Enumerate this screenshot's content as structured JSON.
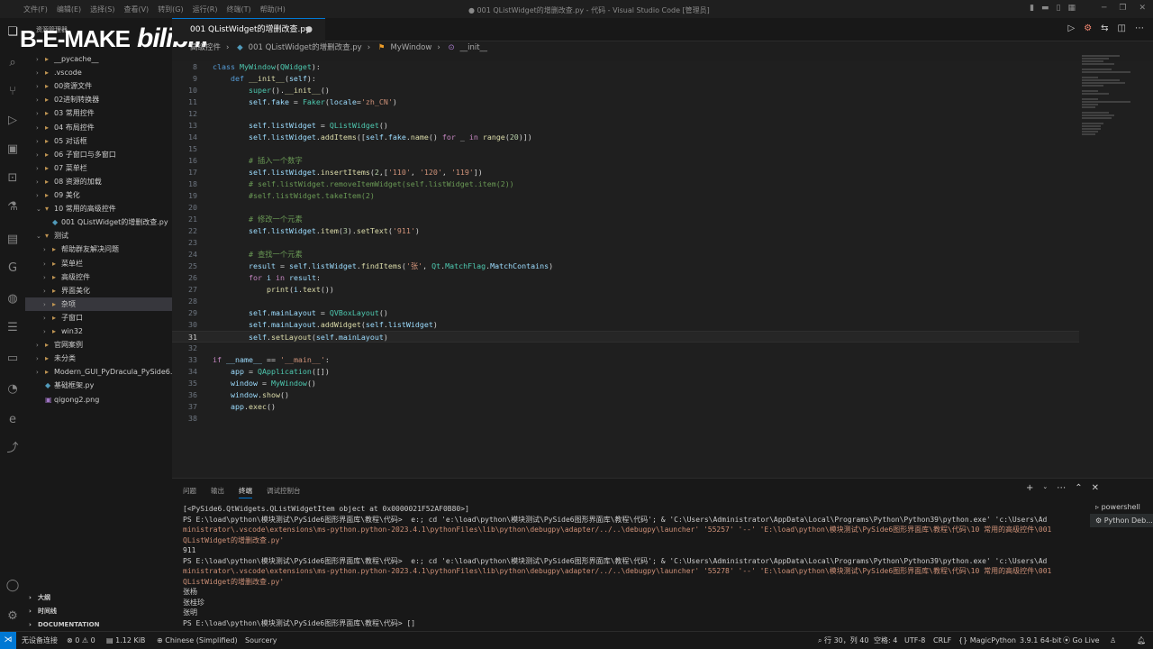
{
  "titlebar": {
    "menus": [
      "文件(F)",
      "编辑(E)",
      "选择(S)",
      "查看(V)",
      "转到(G)",
      "运行(R)",
      "终端(T)",
      "帮助(H)"
    ],
    "window_title": "● 001 QListWidget的增删改查.py - 代码 - Visual Studio Code [管理员]"
  },
  "watermark": {
    "brand": "B-E-MAKE",
    "logo": "bilibili"
  },
  "sidebar": {
    "title": "资源管理器",
    "items": [
      {
        "label": "__pycache__",
        "type": "folder",
        "indent": 1
      },
      {
        "label": ".vscode",
        "type": "folder",
        "indent": 1
      },
      {
        "label": "00资源文件",
        "type": "folder",
        "indent": 1
      },
      {
        "label": "02进制转换器",
        "type": "folder",
        "indent": 1
      },
      {
        "label": "03 常用控件",
        "type": "folder",
        "indent": 1
      },
      {
        "label": "04 布局控件",
        "type": "folder",
        "indent": 1
      },
      {
        "label": "05 对话框",
        "type": "folder",
        "indent": 1
      },
      {
        "label": "06 子窗口与多窗口",
        "type": "folder",
        "indent": 1
      },
      {
        "label": "07 菜单栏",
        "type": "folder",
        "indent": 1
      },
      {
        "label": "08 资源的加载",
        "type": "folder",
        "indent": 1
      },
      {
        "label": "09 美化",
        "type": "folder",
        "indent": 1
      },
      {
        "label": "10 常用的高级控件",
        "type": "folder-open",
        "indent": 1
      },
      {
        "label": "001 QListWidget的增删改查.py",
        "type": "py",
        "indent": 2
      },
      {
        "label": "测试",
        "type": "folder-open",
        "indent": 1
      },
      {
        "label": "帮助群友解决问题",
        "type": "folder",
        "indent": 2
      },
      {
        "label": "菜单栏",
        "type": "folder",
        "indent": 2
      },
      {
        "label": "高级控件",
        "type": "folder",
        "indent": 2
      },
      {
        "label": "界面美化",
        "type": "folder",
        "indent": 2
      },
      {
        "label": "杂项",
        "type": "folder",
        "indent": 2,
        "selected": true
      },
      {
        "label": "子窗口",
        "type": "folder",
        "indent": 2
      },
      {
        "label": "win32",
        "type": "folder",
        "indent": 2
      },
      {
        "label": "官网案例",
        "type": "folder",
        "indent": 1
      },
      {
        "label": "未分类",
        "type": "folder",
        "indent": 1
      },
      {
        "label": "Modern_GUI_PyDracula_PySide6...",
        "type": "folder",
        "indent": 1
      },
      {
        "label": "基础框架.py",
        "type": "py",
        "indent": 1
      },
      {
        "label": "qigong2.png",
        "type": "img",
        "indent": 1
      }
    ],
    "bottom_sections": [
      "大纲",
      "时间线",
      "DOCUMENTATION"
    ]
  },
  "editor": {
    "tab_label": "001 QListWidget的增删改查.py",
    "tab_dirty": "●",
    "breadcrumb": [
      "高级控件",
      "001 QListWidget的增删改查.py",
      "MyWindow",
      "__init__"
    ],
    "current_line": "30"
  },
  "panel": {
    "tabs": [
      "问题",
      "输出",
      "终端",
      "调试控制台"
    ],
    "active_tab": "终端",
    "terminal_lines": [
      "[<PySide6.QtWidgets.QListWidgetItem object at 0x0000021F52AF0B80>]",
      "PS E:\\load\\python\\模块测试\\PySide6图形界面库\\教程\\代码>  e:; cd 'e:\\load\\python\\模块测试\\PySide6图形界面库\\教程\\代码'; & 'C:\\Users\\Administrator\\AppData\\Local\\Programs\\Python\\Python39\\python.exe' 'c:\\Users\\Ad",
      "ministrator\\.vscode\\extensions\\ms-python.python-2023.4.1\\pythonFiles\\lib\\python\\debugpy\\adapter/../..\\debugpy\\launcher' '55257' '--' 'E:\\load\\python\\模块测试\\PySide6图形界面库\\教程\\代码\\10 常用的高级控件\\001",
      "QListWidget的增删改查.py'",
      "911",
      "PS E:\\load\\python\\模块测试\\PySide6图形界面库\\教程\\代码>  e:; cd 'e:\\load\\python\\模块测试\\PySide6图形界面库\\教程\\代码'; & 'C:\\Users\\Administrator\\AppData\\Local\\Programs\\Python\\Python39\\python.exe' 'c:\\Users\\Ad",
      "ministrator\\.vscode\\extensions\\ms-python.python-2023.4.1\\pythonFiles\\lib\\python\\debugpy\\adapter/../..\\debugpy\\launcher' '55278' '--' 'E:\\load\\python\\模块测试\\PySide6图形界面库\\教程\\代码\\10 常用的高级控件\\001",
      "QListWidget的增删改查.py'",
      "张杨",
      "张桂珍",
      "张明",
      "PS E:\\load\\python\\模块测试\\PySide6图形界面库\\教程\\代码> []"
    ],
    "terminals": [
      "powershell",
      "Python Deb..."
    ]
  },
  "statusbar": {
    "remote": "⋊",
    "connection": "无设备连接",
    "errors": "0",
    "warnings": "0",
    "filesize": "1.12 KiB",
    "language_pack": "Chinese (Simplified)",
    "sourcery": "Sourcery",
    "position": "行 30，列 40",
    "spaces": "空格: 4",
    "encoding": "UTF-8",
    "eol": "CRLF",
    "language": "MagicPython",
    "interpreter": "3.9.1 64-bit",
    "golive": "Go Live"
  },
  "colors": {
    "accent": "#0078d4",
    "bg": "#1f1f1f",
    "sidebar": "#181818"
  }
}
